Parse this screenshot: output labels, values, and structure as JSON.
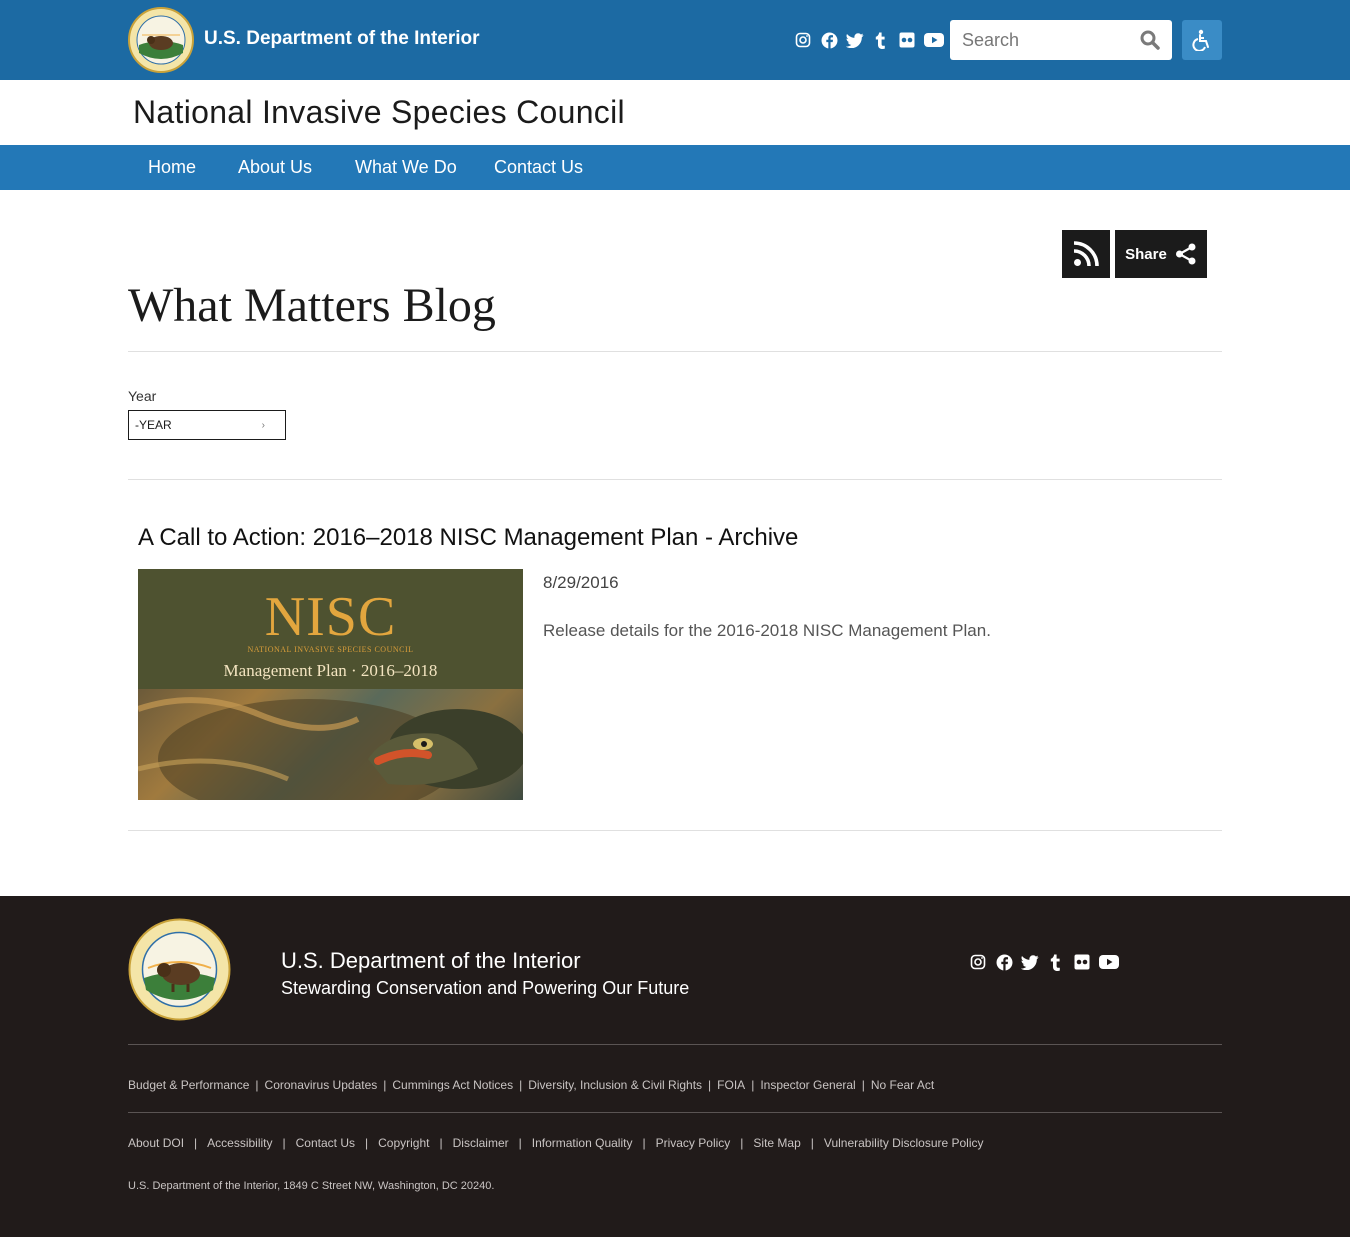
{
  "header": {
    "agency": "U.S. Department of the Interior",
    "search_placeholder": "Search",
    "social": [
      "instagram-icon",
      "facebook-icon",
      "twitter-icon",
      "tumblr-icon",
      "flickr-icon",
      "youtube-icon"
    ]
  },
  "site": {
    "name": "National Invasive Species Council"
  },
  "nav": {
    "items": [
      "Home",
      "About Us",
      "What We Do",
      "Contact Us"
    ]
  },
  "actions": {
    "share_label": "Share"
  },
  "page": {
    "title": "What Matters Blog"
  },
  "filter": {
    "year_label": "Year",
    "year_value": "-YEAR"
  },
  "article": {
    "title": "A Call to Action: 2016–2018 NISC Management Plan - Archive",
    "date": "8/29/2016",
    "description": "Release details for the 2016-2018 NISC Management Plan.",
    "image": {
      "heading": "NISC",
      "subheading": "NATIONAL INVASIVE SPECIES COUNCIL",
      "caption": "Management Plan · 2016–2018"
    }
  },
  "footer": {
    "title": "U.S. Department of the Interior",
    "tagline": "Stewarding Conservation and Powering Our Future",
    "links_row1": [
      "Budget & Performance",
      "Coronavirus Updates",
      "Cummings Act Notices",
      "Diversity, Inclusion & Civil Rights",
      "FOIA",
      "Inspector General",
      "No Fear Act"
    ],
    "links_row2": [
      "About DOI",
      "Accessibility",
      "Contact Us",
      "Copyright",
      "Disclaimer",
      "Information Quality",
      "Privacy Policy",
      "Site Map",
      "Vulnerability Disclosure Policy"
    ],
    "address": "U.S. Department of the Interior, 1849 C Street NW, Washington, DC 20240."
  },
  "colors": {
    "header_bg": "#1c6aa3",
    "nav_bg": "#2378b7",
    "footer_bg": "#211b1a",
    "accent_gold": "#e3a63e"
  }
}
